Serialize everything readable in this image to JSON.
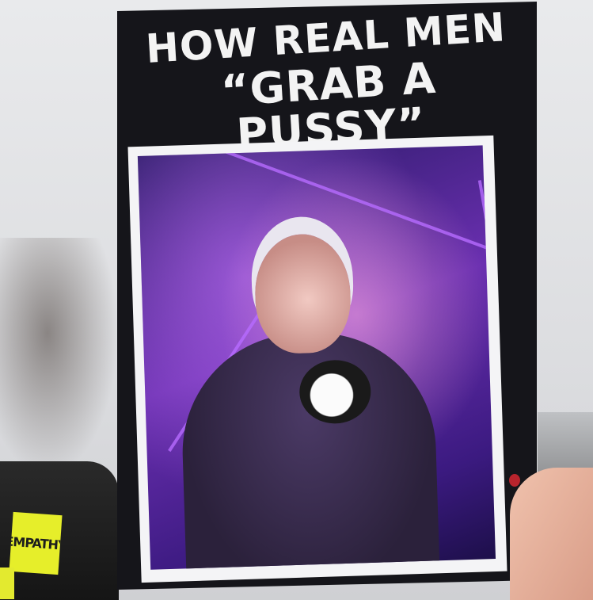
{
  "sign": {
    "line1": "HOW REAL MEN",
    "line2": "“GRAB A PUSSY”"
  },
  "background_sign": {
    "text": "EMPATHY"
  },
  "colors": {
    "board": "#15151a",
    "text": "#f3f3f3",
    "poster_purple": "#6a2fb0",
    "empathy_sign": "#e6ee2a"
  }
}
